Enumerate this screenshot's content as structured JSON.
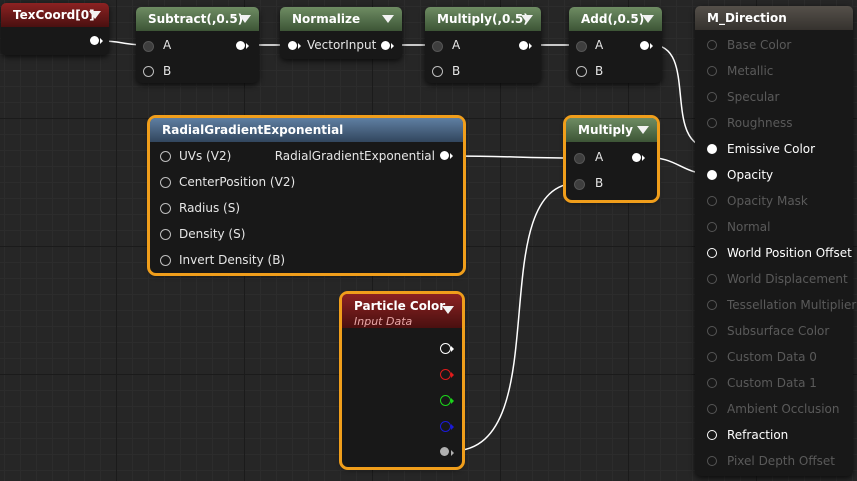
{
  "nodes": {
    "texcoord": {
      "title": "TexCoord[0]"
    },
    "subtract": {
      "title": "Subtract(,0.5)",
      "in_a": "A",
      "in_b": "B"
    },
    "normalize": {
      "title": "Normalize",
      "in": "VectorInput"
    },
    "multiply_top": {
      "title": "Multiply(,0.5)",
      "in_a": "A",
      "in_b": "B"
    },
    "add": {
      "title": "Add(,0.5)",
      "in_a": "A",
      "in_b": "B"
    },
    "radial": {
      "title": "RadialGradientExponential",
      "inputs": [
        "UVs (V2)",
        "CenterPosition (V2)",
        "Radius (S)",
        "Density (S)",
        "Invert Density (B)"
      ],
      "output": "RadialGradientExponential"
    },
    "multiply": {
      "title": "Multiply",
      "in_a": "A",
      "in_b": "B"
    },
    "particle": {
      "title": "Particle Color",
      "subtitle": "Input Data"
    }
  },
  "material": {
    "title": "M_Direction",
    "pins": [
      {
        "label": "Base Color",
        "enabled": false
      },
      {
        "label": "Metallic",
        "enabled": false
      },
      {
        "label": "Specular",
        "enabled": false
      },
      {
        "label": "Roughness",
        "enabled": false
      },
      {
        "label": "Emissive Color",
        "enabled": true,
        "connected": true
      },
      {
        "label": "Opacity",
        "enabled": true,
        "connected": true
      },
      {
        "label": "Opacity Mask",
        "enabled": false
      },
      {
        "label": "Normal",
        "enabled": false
      },
      {
        "label": "World Position Offset",
        "enabled": true,
        "connected": false
      },
      {
        "label": "World Displacement",
        "enabled": false
      },
      {
        "label": "Tessellation Multiplier",
        "enabled": false
      },
      {
        "label": "Subsurface Color",
        "enabled": false
      },
      {
        "label": "Custom Data 0",
        "enabled": false
      },
      {
        "label": "Custom Data 1",
        "enabled": false
      },
      {
        "label": "Ambient Occlusion",
        "enabled": false
      },
      {
        "label": "Refraction",
        "enabled": true,
        "connected": false
      },
      {
        "label": "Pixel Depth Offset",
        "enabled": false
      }
    ]
  },
  "colors": {
    "selection": "#f09e1b",
    "pin_red": "#e01b1b",
    "pin_green": "#1bd31b",
    "pin_blue": "#1b1bd8",
    "pin_white": "#ffffff",
    "pin_gray": "#b0b0b0"
  }
}
